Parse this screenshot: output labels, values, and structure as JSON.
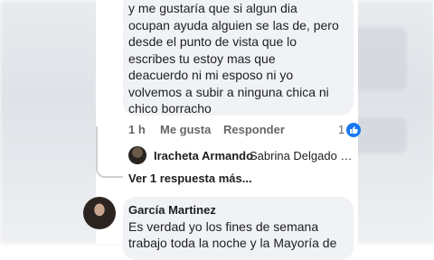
{
  "comment1": {
    "text": "y me gustaría que si algun dia\nocupan ayuda alguien se las de, pero\ndesde el punto de vista que lo\nescribes tu estoy mas que\ndeacuerdo ni mi esposo ni yo\nvolvemos a subir a ninguna chica ni\nchico borracho",
    "time": "1 h",
    "like_label": "Me gusta",
    "reply_label": "Responder",
    "reaction_count": "1"
  },
  "reply_preview": {
    "name": "Iracheta Armando",
    "text": "Sabrina Delgado no t..."
  },
  "more_replies": "Ver 1 respuesta más...",
  "comment2": {
    "name": "García Martinez",
    "text": "Es verdad yo los fines de semana\ntrabajo toda la noche y la Mayoría de"
  },
  "colors": {
    "bubble": "#f0f2f5",
    "like_blue": "#1877f2",
    "meta_text": "#65676b"
  }
}
